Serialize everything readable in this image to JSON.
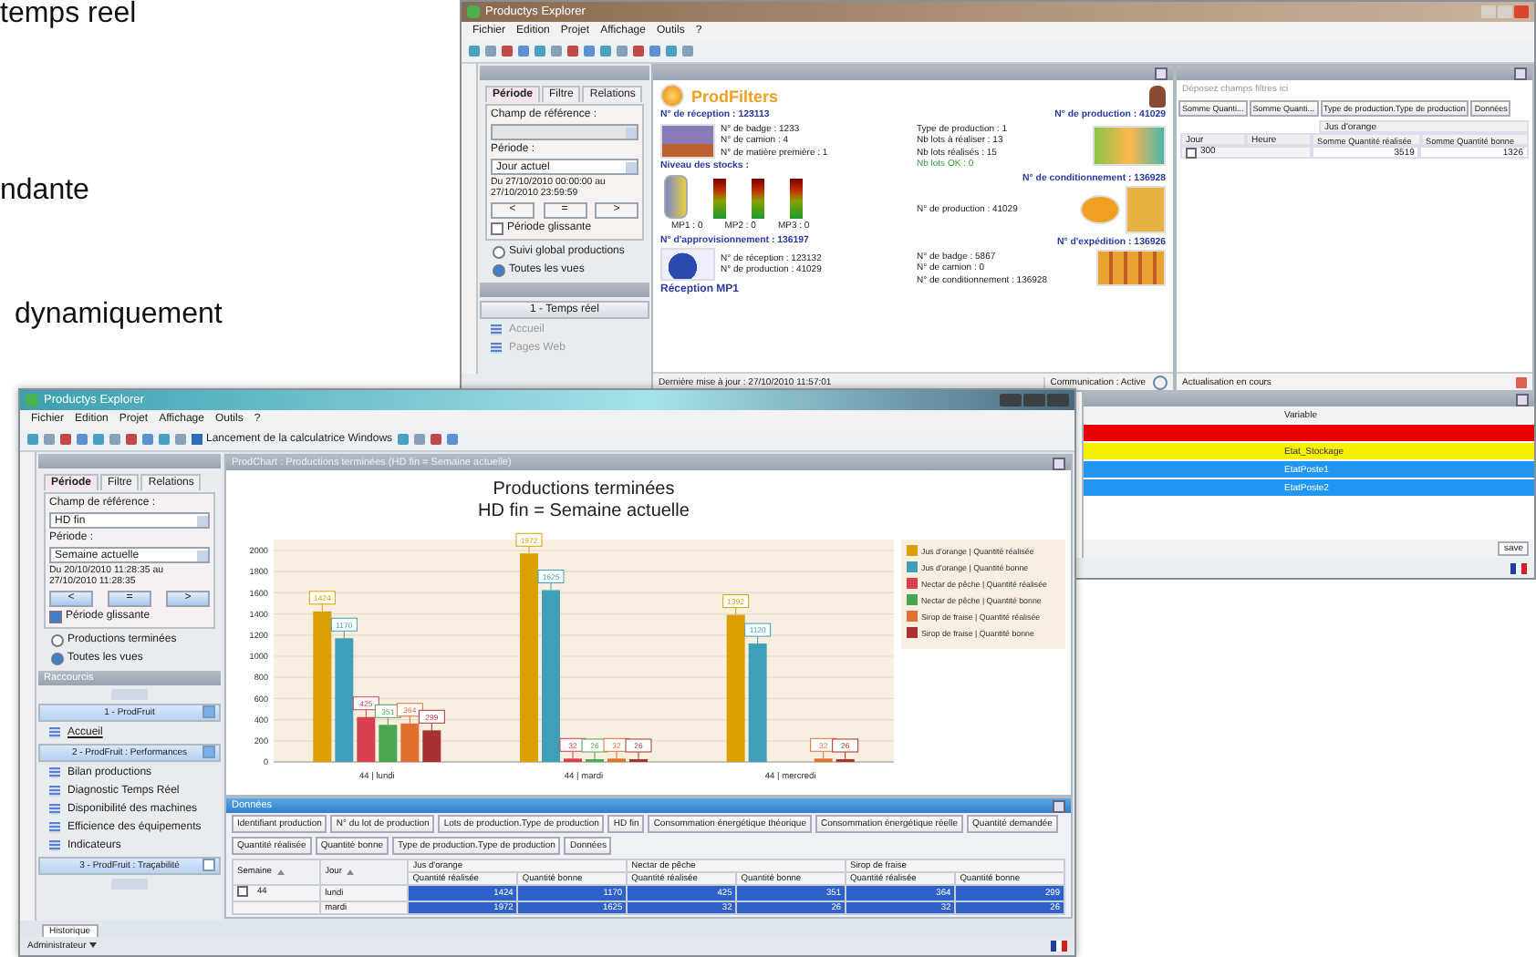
{
  "page_fragments": [
    "temps reel",
    "ndante",
    "dynamiquement"
  ],
  "back_window": {
    "title": "Productys Explorer",
    "menu": [
      "Fichier",
      "Edition",
      "Projet",
      "Affichage",
      "Outils",
      "?"
    ],
    "filter_panel": {
      "tabs": [
        {
          "label": "Période",
          "selected": true
        },
        {
          "label": "Filtre",
          "selected": false
        },
        {
          "label": "Relations",
          "selected": false
        }
      ],
      "reference_label": "Champ de référence :",
      "period_label": "Période :",
      "period_value": "Jour actuel",
      "range": "Du 27/10/2010 00:00:00 au 27/10/2010 23:59:59",
      "nav_buttons": [
        "<",
        "=",
        ">"
      ],
      "sliding": {
        "label": "Période glissante",
        "checked": false
      },
      "views": [
        {
          "label": "Suivi global productions",
          "selected": false
        },
        {
          "label": "Toutes les vues",
          "selected": true
        }
      ]
    },
    "shortcuts": {
      "group": "1 - Temps réel",
      "items": [
        "Accueil",
        "Pages Web"
      ]
    },
    "dashboard": {
      "brand": "ProdFilters",
      "reception": {
        "heading": "N° de réception : 123113",
        "lines": [
          "N° de badge : 1233",
          "N° de camion : 4",
          "N° de matière première : 1"
        ]
      },
      "stocks": {
        "heading": "Niveau des stocks :",
        "labels": [
          "MP1 : 0",
          "MP2 : 0",
          "MP3 : 0"
        ]
      },
      "supply": {
        "heading": "N° d'approvisionnement : 136197",
        "lines": [
          "N° de réception : 123132",
          "N° de production : 41029"
        ]
      },
      "footer": "Réception MP1",
      "production": {
        "heading": "N° de production : 41029",
        "lines": [
          "Type de production : 1",
          "Nb lots à réaliser : 13",
          "Nb lots réalisés : 15"
        ],
        "ok_line": "Nb lots OK : 0"
      },
      "packaging": {
        "heading": "N° de conditionnement : 136928",
        "lines": [
          "N° de production : 41029"
        ]
      },
      "shipping": {
        "heading": "N° d'expédition : 136926",
        "lines": [
          "N° de badge : 5867",
          "N° de camion : 0",
          "N° de conditionnement : 136928"
        ]
      },
      "updated": "Dernière mise à jour : 27/10/2010 11:57:01",
      "communication": "Communication : Active"
    },
    "pivot": {
      "drop_hint": "Déposez champs filtres ici",
      "fields": [
        "Somme Quanti...",
        "Somme Quanti...",
        "Type de production.Type de production",
        "Données"
      ],
      "group": "Jus d'orange",
      "row_fields": [
        "Jour",
        "Heure"
      ],
      "columns": [
        "Somme Quantité réalisée",
        "Somme Quantité bonne"
      ],
      "rows": [
        {
          "label": "300",
          "values": [
            "3519",
            "1326"
          ]
        }
      ],
      "status": "Actualisation en cours"
    },
    "alarms": {
      "column": "Variable",
      "button": "save",
      "rows": [
        {
          "color": "#e80000"
        },
        {
          "variable": "Etat_Stockage",
          "color": "#f5f000"
        },
        {
          "variable": "EtatPoste1",
          "color": "#2196f3"
        },
        {
          "variable": "EtatPoste2",
          "color": "#2196f3"
        }
      ]
    }
  },
  "front_window": {
    "title": "Productys Explorer",
    "menu": [
      "Fichier",
      "Edition",
      "Projet",
      "Affichage",
      "Outils",
      "?"
    ],
    "toolbar_action": "Lancement de la calculatrice Windows",
    "filter_panel": {
      "tabs": [
        {
          "label": "Période",
          "selected": true
        },
        {
          "label": "Filtre",
          "selected": false
        },
        {
          "label": "Relations",
          "selected": false
        }
      ],
      "reference_label": "Champ de référence :",
      "reference_value": "HD fin",
      "period_label": "Période :",
      "period_value": "Semaine actuelle",
      "range": "Du 20/10/2010 11:28:35 au 27/10/2010 11:28:35",
      "nav_buttons": [
        "<",
        "=",
        ">"
      ],
      "sliding": {
        "label": "Période glissante",
        "checked": true
      },
      "views": [
        {
          "label": "Productions terminées",
          "selected": false
        },
        {
          "label": "Toutes les vues",
          "selected": true
        }
      ]
    },
    "shortcuts": {
      "title": "Raccourcis",
      "groups": [
        {
          "label": "1 - ProdFruit",
          "expanded": true,
          "items": [
            "Accueil"
          ]
        },
        {
          "label": "2 - ProdFruit : Performances",
          "expanded": true,
          "items": [
            "Bilan productions",
            "Diagnostic Temps Réel",
            "Disponibilité des machines",
            "Efficience des équipements",
            "Indicateurs"
          ]
        },
        {
          "label": "3 - ProdFruit : Traçabilité",
          "expanded": false
        }
      ]
    },
    "chart_panel_title": "ProdChart : Productions terminées (HD fin = Semaine actuelle)",
    "chart": {
      "chart_data": {
        "type": "bar",
        "title": "Productions terminées\nHD fin = Semaine actuelle",
        "categories": [
          "44 | lundi",
          "44 | mardi",
          "44 | mercredi"
        ],
        "series": [
          {
            "name": "Jus d'orange | Quantité réalisée",
            "color": "#d9a000",
            "values": [
              1424,
              1972,
              1392
            ]
          },
          {
            "name": "Jus d'orange | Quantité bonne",
            "color": "#3f9fb8",
            "values": [
              1170,
              1625,
              1120
            ]
          },
          {
            "name": "Nectar de pêche | Quantité réalisée",
            "color": "#d8404f",
            "values": [
              425,
              32,
              null
            ]
          },
          {
            "name": "Nectar de pêche | Quantité bonne",
            "color": "#4aa650",
            "values": [
              351,
              26,
              null
            ]
          },
          {
            "name": "Sirop de fraise | Quantité réalisée",
            "color": "#e07030",
            "values": [
              364,
              32,
              32
            ]
          },
          {
            "name": "Sirop de fraise | Quantité bonne",
            "color": "#a83232",
            "values": [
              299,
              26,
              26
            ]
          }
        ],
        "ylim": [
          0,
          2000
        ],
        "yticks": [
          0,
          200,
          400,
          600,
          800,
          1000,
          1200,
          1400,
          1600,
          1800,
          2000
        ],
        "data_labels": true,
        "grid": true,
        "legend": true
      }
    },
    "data_panel": {
      "title": "Données",
      "field_buttons": [
        "Identifiant production",
        "N° du lot de production",
        "Lots de production.Type de production",
        "HD fin",
        "Consommation énergétique théorique",
        "Consommation énergétique réelle",
        "Quantité demandée"
      ],
      "data_fields": [
        "Quantité réalisée",
        "Quantité bonne",
        "Type de production.Type de production",
        "Données"
      ],
      "row_fields": [
        "Semaine",
        "Jour"
      ],
      "groups": [
        {
          "label": "Jus d'orange",
          "measures": [
            "Quantité réalisée",
            "Quantité bonne"
          ]
        },
        {
          "label": "Nectar de pêche",
          "measures": [
            "Quantité réalisée",
            "Quantité bonne"
          ]
        },
        {
          "label": "Sirop de fraise",
          "measures": [
            "Quantité réalisée",
            "Quantité bonne"
          ]
        }
      ],
      "rows": [
        {
          "week": "44",
          "day": "lundi",
          "values": [
            "1424",
            "1170",
            "425",
            "351",
            "364",
            "299"
          ],
          "selected": true
        },
        {
          "day": "mardi",
          "values": [
            "1972",
            "1625",
            "32",
            "26",
            "32",
            "26"
          ],
          "selected": true
        }
      ]
    },
    "bottom_tab": "Historique",
    "user": "Administrateur"
  }
}
